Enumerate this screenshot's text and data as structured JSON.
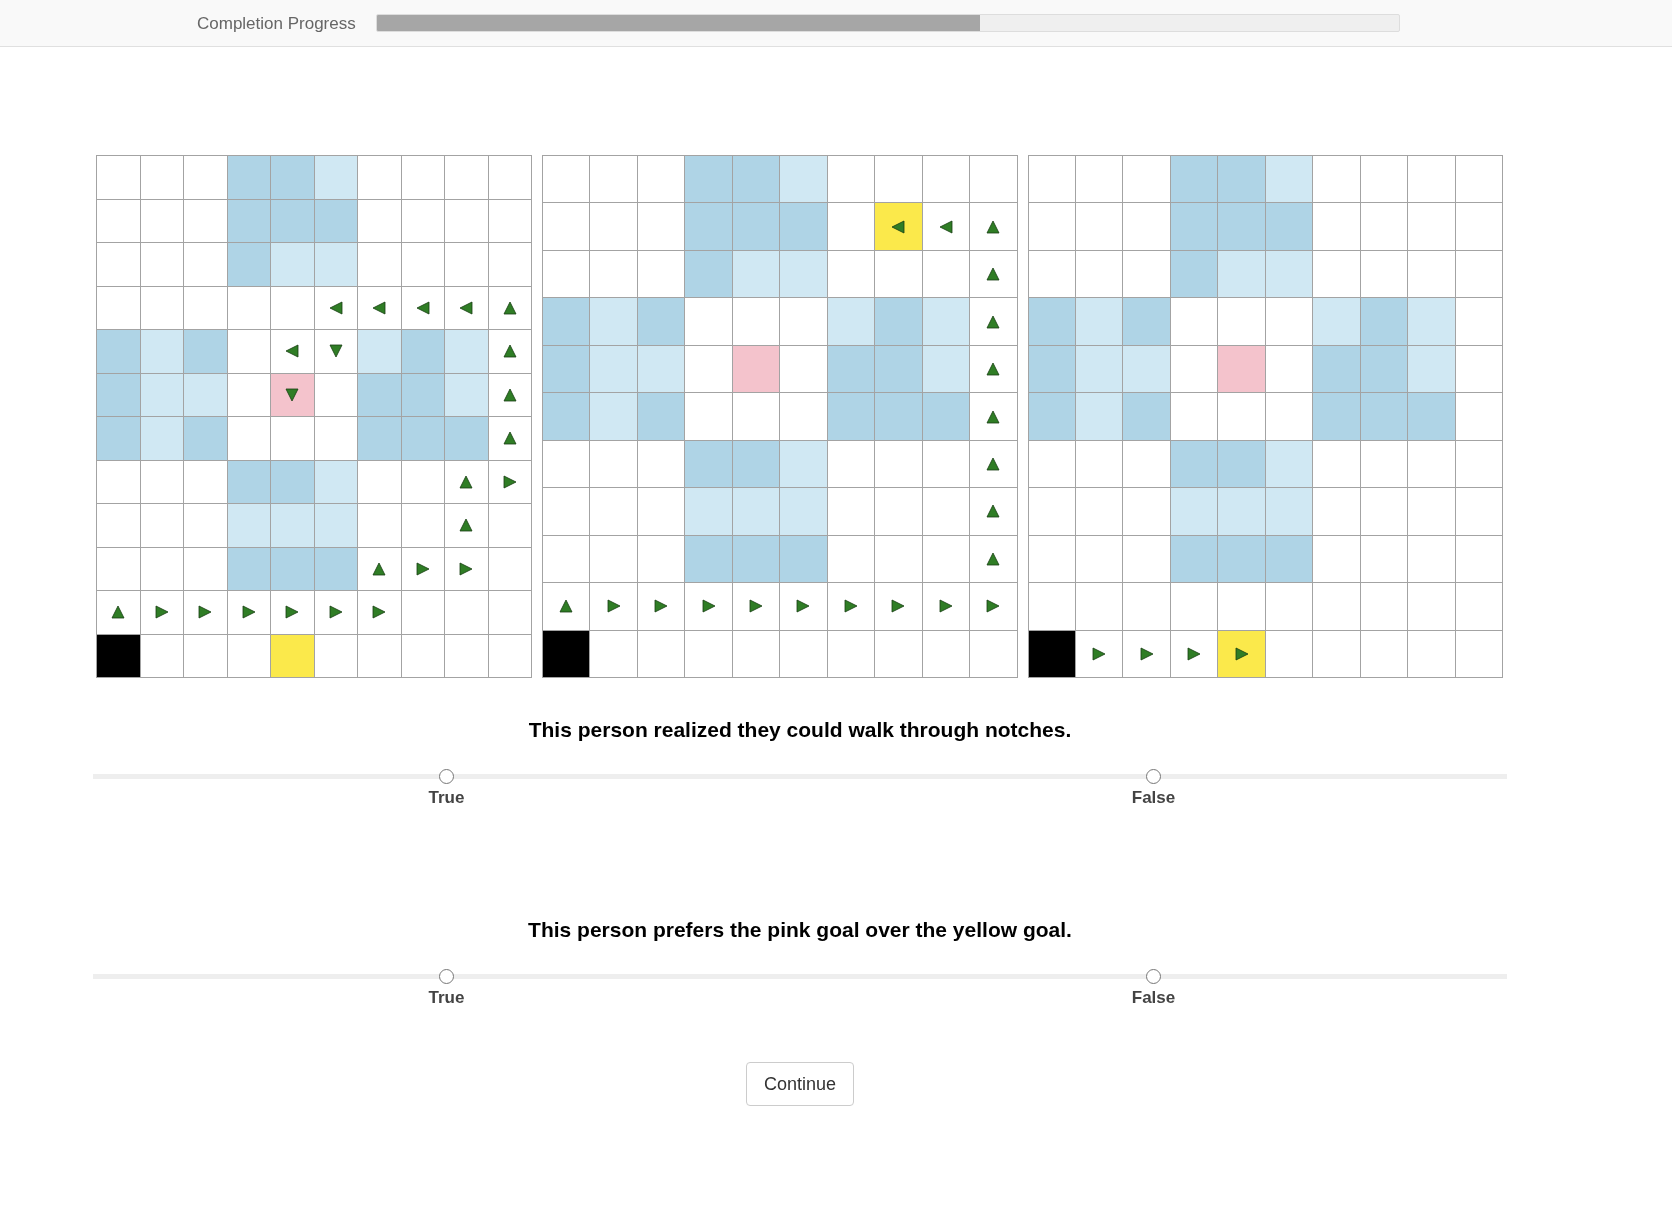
{
  "progress": {
    "label": "Completion Progress",
    "level": 0.59
  },
  "grids": [
    {
      "rows": [
        {
          "cells": [
            {
              "color": "#ffffff",
              "kind": "empty"
            },
            {
              "color": "#ffffff",
              "kind": "empty"
            },
            {
              "color": "#ffffff",
              "kind": "empty"
            },
            {
              "color": "#afd4e6",
              "kind": "empty"
            },
            {
              "color": "#afd4e6",
              "kind": "empty"
            },
            {
              "color": "#d0e8f3",
              "kind": "empty"
            },
            {
              "color": "#ffffff",
              "kind": "empty"
            },
            {
              "color": "#ffffff",
              "kind": "empty"
            },
            {
              "color": "#ffffff",
              "kind": "empty"
            },
            {
              "color": "#ffffff",
              "kind": "empty"
            }
          ]
        },
        {
          "cells": [
            {
              "color": "#ffffff",
              "kind": "empty"
            },
            {
              "color": "#ffffff",
              "kind": "empty"
            },
            {
              "color": "#ffffff",
              "kind": "empty"
            },
            {
              "color": "#afd4e6",
              "kind": "empty"
            },
            {
              "color": "#afd4e6",
              "kind": "empty"
            },
            {
              "color": "#afd4e6",
              "kind": "empty"
            },
            {
              "color": "#ffffff",
              "kind": "empty"
            },
            {
              "color": "#ffffff",
              "kind": "empty"
            },
            {
              "color": "#ffffff",
              "kind": "empty"
            },
            {
              "color": "#ffffff",
              "kind": "empty"
            }
          ]
        },
        {
          "cells": [
            {
              "color": "#ffffff",
              "kind": "empty"
            },
            {
              "color": "#ffffff",
              "kind": "empty"
            },
            {
              "color": "#ffffff",
              "kind": "empty"
            },
            {
              "color": "#afd4e6",
              "kind": "empty"
            },
            {
              "color": "#d0e8f3",
              "kind": "empty"
            },
            {
              "color": "#d0e8f3",
              "kind": "empty"
            },
            {
              "color": "#ffffff",
              "kind": "empty"
            },
            {
              "color": "#ffffff",
              "kind": "empty"
            },
            {
              "color": "#ffffff",
              "kind": "empty"
            },
            {
              "color": "#ffffff",
              "kind": "empty"
            }
          ]
        },
        {
          "cells": [
            {
              "color": "#ffffff",
              "kind": "empty"
            },
            {
              "color": "#ffffff",
              "kind": "empty"
            },
            {
              "color": "#ffffff",
              "kind": "empty"
            },
            {
              "color": "#ffffff",
              "kind": "empty"
            },
            {
              "color": "#ffffff",
              "kind": "empty"
            },
            {
              "color": "#ffffff",
              "kind": "left"
            },
            {
              "color": "#ffffff",
              "kind": "left"
            },
            {
              "color": "#ffffff",
              "kind": "left"
            },
            {
              "color": "#ffffff",
              "kind": "left"
            },
            {
              "color": "#ffffff",
              "kind": "up"
            }
          ]
        },
        {
          "cells": [
            {
              "color": "#afd4e6",
              "kind": "empty"
            },
            {
              "color": "#d0e8f3",
              "kind": "empty"
            },
            {
              "color": "#afd4e6",
              "kind": "empty"
            },
            {
              "color": "#ffffff",
              "kind": "empty"
            },
            {
              "color": "#ffffff",
              "kind": "left"
            },
            {
              "color": "#ffffff",
              "kind": "down"
            },
            {
              "color": "#d0e8f3",
              "kind": "empty"
            },
            {
              "color": "#afd4e6",
              "kind": "empty"
            },
            {
              "color": "#d0e8f3",
              "kind": "empty"
            },
            {
              "color": "#ffffff",
              "kind": "up"
            }
          ]
        },
        {
          "cells": [
            {
              "color": "#afd4e6",
              "kind": "empty"
            },
            {
              "color": "#d0e8f3",
              "kind": "empty"
            },
            {
              "color": "#d0e8f3",
              "kind": "empty"
            },
            {
              "color": "#ffffff",
              "kind": "empty"
            },
            {
              "color": "#f4c3cc",
              "kind": "down"
            },
            {
              "color": "#ffffff",
              "kind": "empty"
            },
            {
              "color": "#afd4e6",
              "kind": "empty"
            },
            {
              "color": "#afd4e6",
              "kind": "empty"
            },
            {
              "color": "#d0e8f3",
              "kind": "empty"
            },
            {
              "color": "#ffffff",
              "kind": "up"
            }
          ]
        },
        {
          "cells": [
            {
              "color": "#afd4e6",
              "kind": "empty"
            },
            {
              "color": "#d0e8f3",
              "kind": "empty"
            },
            {
              "color": "#afd4e6",
              "kind": "empty"
            },
            {
              "color": "#ffffff",
              "kind": "empty"
            },
            {
              "color": "#ffffff",
              "kind": "empty"
            },
            {
              "color": "#ffffff",
              "kind": "empty"
            },
            {
              "color": "#afd4e6",
              "kind": "empty"
            },
            {
              "color": "#afd4e6",
              "kind": "empty"
            },
            {
              "color": "#afd4e6",
              "kind": "empty"
            },
            {
              "color": "#ffffff",
              "kind": "up"
            }
          ]
        },
        {
          "cells": [
            {
              "color": "#ffffff",
              "kind": "empty"
            },
            {
              "color": "#ffffff",
              "kind": "empty"
            },
            {
              "color": "#ffffff",
              "kind": "empty"
            },
            {
              "color": "#afd4e6",
              "kind": "empty"
            },
            {
              "color": "#afd4e6",
              "kind": "empty"
            },
            {
              "color": "#d0e8f3",
              "kind": "empty"
            },
            {
              "color": "#ffffff",
              "kind": "empty"
            },
            {
              "color": "#ffffff",
              "kind": "empty"
            },
            {
              "color": "#ffffff",
              "kind": "up"
            },
            {
              "color": "#ffffff",
              "kind": "right"
            }
          ]
        },
        {
          "cells": [
            {
              "color": "#ffffff",
              "kind": "empty"
            },
            {
              "color": "#ffffff",
              "kind": "empty"
            },
            {
              "color": "#ffffff",
              "kind": "empty"
            },
            {
              "color": "#d0e8f3",
              "kind": "empty"
            },
            {
              "color": "#d0e8f3",
              "kind": "empty"
            },
            {
              "color": "#d0e8f3",
              "kind": "empty"
            },
            {
              "color": "#ffffff",
              "kind": "empty"
            },
            {
              "color": "#ffffff",
              "kind": "empty"
            },
            {
              "color": "#ffffff",
              "kind": "up"
            },
            {
              "color": "#ffffff",
              "kind": "empty"
            }
          ]
        },
        {
          "cells": [
            {
              "color": "#ffffff",
              "kind": "empty"
            },
            {
              "color": "#ffffff",
              "kind": "empty"
            },
            {
              "color": "#ffffff",
              "kind": "empty"
            },
            {
              "color": "#afd4e6",
              "kind": "empty"
            },
            {
              "color": "#afd4e6",
              "kind": "empty"
            },
            {
              "color": "#afd4e6",
              "kind": "empty"
            },
            {
              "color": "#ffffff",
              "kind": "up"
            },
            {
              "color": "#ffffff",
              "kind": "right"
            },
            {
              "color": "#ffffff",
              "kind": "right"
            },
            {
              "color": "#ffffff",
              "kind": "empty"
            }
          ]
        },
        {
          "cells": [
            {
              "color": "#ffffff",
              "kind": "up"
            },
            {
              "color": "#ffffff",
              "kind": "right"
            },
            {
              "color": "#ffffff",
              "kind": "right"
            },
            {
              "color": "#ffffff",
              "kind": "right"
            },
            {
              "color": "#ffffff",
              "kind": "right"
            },
            {
              "color": "#ffffff",
              "kind": "right"
            },
            {
              "color": "#ffffff",
              "kind": "right"
            },
            {
              "color": "#ffffff",
              "kind": "empty"
            },
            {
              "color": "#ffffff",
              "kind": "empty"
            },
            {
              "color": "#ffffff",
              "kind": "empty"
            }
          ]
        },
        {
          "cells": [
            {
              "color": "#000000",
              "kind": "empty"
            },
            {
              "color": "#ffffff",
              "kind": "empty"
            },
            {
              "color": "#ffffff",
              "kind": "empty"
            },
            {
              "color": "#ffffff",
              "kind": "empty"
            },
            {
              "color": "#fbe94b",
              "kind": "empty"
            },
            {
              "color": "#ffffff",
              "kind": "empty"
            },
            {
              "color": "#ffffff",
              "kind": "empty"
            },
            {
              "color": "#ffffff",
              "kind": "empty"
            },
            {
              "color": "#ffffff",
              "kind": "empty"
            },
            {
              "color": "#ffffff",
              "kind": "empty"
            }
          ]
        }
      ]
    },
    {
      "rows": [
        {
          "cells": [
            {
              "color": "#ffffff",
              "kind": "empty"
            },
            {
              "color": "#ffffff",
              "kind": "empty"
            },
            {
              "color": "#ffffff",
              "kind": "empty"
            },
            {
              "color": "#afd4e6",
              "kind": "empty"
            },
            {
              "color": "#afd4e6",
              "kind": "empty"
            },
            {
              "color": "#d0e8f3",
              "kind": "empty"
            },
            {
              "color": "#ffffff",
              "kind": "empty"
            },
            {
              "color": "#ffffff",
              "kind": "empty"
            },
            {
              "color": "#ffffff",
              "kind": "empty"
            },
            {
              "color": "#ffffff",
              "kind": "empty"
            }
          ]
        },
        {
          "cells": [
            {
              "color": "#ffffff",
              "kind": "empty"
            },
            {
              "color": "#ffffff",
              "kind": "empty"
            },
            {
              "color": "#ffffff",
              "kind": "empty"
            },
            {
              "color": "#afd4e6",
              "kind": "empty"
            },
            {
              "color": "#afd4e6",
              "kind": "empty"
            },
            {
              "color": "#afd4e6",
              "kind": "empty"
            },
            {
              "color": "#ffffff",
              "kind": "empty"
            },
            {
              "color": "#fbe94b",
              "kind": "left"
            },
            {
              "color": "#ffffff",
              "kind": "left"
            },
            {
              "color": "#ffffff",
              "kind": "up"
            }
          ]
        },
        {
          "cells": [
            {
              "color": "#ffffff",
              "kind": "empty"
            },
            {
              "color": "#ffffff",
              "kind": "empty"
            },
            {
              "color": "#ffffff",
              "kind": "empty"
            },
            {
              "color": "#afd4e6",
              "kind": "empty"
            },
            {
              "color": "#d0e8f3",
              "kind": "empty"
            },
            {
              "color": "#d0e8f3",
              "kind": "empty"
            },
            {
              "color": "#ffffff",
              "kind": "empty"
            },
            {
              "color": "#ffffff",
              "kind": "empty"
            },
            {
              "color": "#ffffff",
              "kind": "empty"
            },
            {
              "color": "#ffffff",
              "kind": "up"
            }
          ]
        },
        {
          "cells": [
            {
              "color": "#afd4e6",
              "kind": "empty"
            },
            {
              "color": "#d0e8f3",
              "kind": "empty"
            },
            {
              "color": "#afd4e6",
              "kind": "empty"
            },
            {
              "color": "#ffffff",
              "kind": "empty"
            },
            {
              "color": "#ffffff",
              "kind": "empty"
            },
            {
              "color": "#ffffff",
              "kind": "empty"
            },
            {
              "color": "#d0e8f3",
              "kind": "empty"
            },
            {
              "color": "#afd4e6",
              "kind": "empty"
            },
            {
              "color": "#d0e8f3",
              "kind": "empty"
            },
            {
              "color": "#ffffff",
              "kind": "up"
            }
          ]
        },
        {
          "cells": [
            {
              "color": "#afd4e6",
              "kind": "empty"
            },
            {
              "color": "#d0e8f3",
              "kind": "empty"
            },
            {
              "color": "#d0e8f3",
              "kind": "empty"
            },
            {
              "color": "#ffffff",
              "kind": "empty"
            },
            {
              "color": "#f4c3cc",
              "kind": "empty"
            },
            {
              "color": "#ffffff",
              "kind": "empty"
            },
            {
              "color": "#afd4e6",
              "kind": "empty"
            },
            {
              "color": "#afd4e6",
              "kind": "empty"
            },
            {
              "color": "#d0e8f3",
              "kind": "empty"
            },
            {
              "color": "#ffffff",
              "kind": "up"
            }
          ]
        },
        {
          "cells": [
            {
              "color": "#afd4e6",
              "kind": "empty"
            },
            {
              "color": "#d0e8f3",
              "kind": "empty"
            },
            {
              "color": "#afd4e6",
              "kind": "empty"
            },
            {
              "color": "#ffffff",
              "kind": "empty"
            },
            {
              "color": "#ffffff",
              "kind": "empty"
            },
            {
              "color": "#ffffff",
              "kind": "empty"
            },
            {
              "color": "#afd4e6",
              "kind": "empty"
            },
            {
              "color": "#afd4e6",
              "kind": "empty"
            },
            {
              "color": "#afd4e6",
              "kind": "empty"
            },
            {
              "color": "#ffffff",
              "kind": "up"
            }
          ]
        },
        {
          "cells": [
            {
              "color": "#ffffff",
              "kind": "empty"
            },
            {
              "color": "#ffffff",
              "kind": "empty"
            },
            {
              "color": "#ffffff",
              "kind": "empty"
            },
            {
              "color": "#afd4e6",
              "kind": "empty"
            },
            {
              "color": "#afd4e6",
              "kind": "empty"
            },
            {
              "color": "#d0e8f3",
              "kind": "empty"
            },
            {
              "color": "#ffffff",
              "kind": "empty"
            },
            {
              "color": "#ffffff",
              "kind": "empty"
            },
            {
              "color": "#ffffff",
              "kind": "empty"
            },
            {
              "color": "#ffffff",
              "kind": "up"
            }
          ]
        },
        {
          "cells": [
            {
              "color": "#ffffff",
              "kind": "empty"
            },
            {
              "color": "#ffffff",
              "kind": "empty"
            },
            {
              "color": "#ffffff",
              "kind": "empty"
            },
            {
              "color": "#d0e8f3",
              "kind": "empty"
            },
            {
              "color": "#d0e8f3",
              "kind": "empty"
            },
            {
              "color": "#d0e8f3",
              "kind": "empty"
            },
            {
              "color": "#ffffff",
              "kind": "empty"
            },
            {
              "color": "#ffffff",
              "kind": "empty"
            },
            {
              "color": "#ffffff",
              "kind": "empty"
            },
            {
              "color": "#ffffff",
              "kind": "up"
            }
          ]
        },
        {
          "cells": [
            {
              "color": "#ffffff",
              "kind": "empty"
            },
            {
              "color": "#ffffff",
              "kind": "empty"
            },
            {
              "color": "#ffffff",
              "kind": "empty"
            },
            {
              "color": "#afd4e6",
              "kind": "empty"
            },
            {
              "color": "#afd4e6",
              "kind": "empty"
            },
            {
              "color": "#afd4e6",
              "kind": "empty"
            },
            {
              "color": "#ffffff",
              "kind": "empty"
            },
            {
              "color": "#ffffff",
              "kind": "empty"
            },
            {
              "color": "#ffffff",
              "kind": "empty"
            },
            {
              "color": "#ffffff",
              "kind": "up"
            }
          ]
        },
        {
          "cells": [
            {
              "color": "#ffffff",
              "kind": "up"
            },
            {
              "color": "#ffffff",
              "kind": "right"
            },
            {
              "color": "#ffffff",
              "kind": "right"
            },
            {
              "color": "#ffffff",
              "kind": "right"
            },
            {
              "color": "#ffffff",
              "kind": "right"
            },
            {
              "color": "#ffffff",
              "kind": "right"
            },
            {
              "color": "#ffffff",
              "kind": "right"
            },
            {
              "color": "#ffffff",
              "kind": "right"
            },
            {
              "color": "#ffffff",
              "kind": "right"
            },
            {
              "color": "#ffffff",
              "kind": "right"
            }
          ]
        },
        {
          "cells": [
            {
              "color": "#000000",
              "kind": "empty"
            },
            {
              "color": "#ffffff",
              "kind": "empty"
            },
            {
              "color": "#ffffff",
              "kind": "empty"
            },
            {
              "color": "#ffffff",
              "kind": "empty"
            },
            {
              "color": "#ffffff",
              "kind": "empty"
            },
            {
              "color": "#ffffff",
              "kind": "empty"
            },
            {
              "color": "#ffffff",
              "kind": "empty"
            },
            {
              "color": "#ffffff",
              "kind": "empty"
            },
            {
              "color": "#ffffff",
              "kind": "empty"
            },
            {
              "color": "#ffffff",
              "kind": "empty"
            }
          ]
        }
      ]
    },
    {
      "rows": [
        {
          "cells": [
            {
              "color": "#ffffff",
              "kind": "empty"
            },
            {
              "color": "#ffffff",
              "kind": "empty"
            },
            {
              "color": "#ffffff",
              "kind": "empty"
            },
            {
              "color": "#afd4e6",
              "kind": "empty"
            },
            {
              "color": "#afd4e6",
              "kind": "empty"
            },
            {
              "color": "#d0e8f3",
              "kind": "empty"
            },
            {
              "color": "#ffffff",
              "kind": "empty"
            },
            {
              "color": "#ffffff",
              "kind": "empty"
            },
            {
              "color": "#ffffff",
              "kind": "empty"
            },
            {
              "color": "#ffffff",
              "kind": "empty"
            }
          ]
        },
        {
          "cells": [
            {
              "color": "#ffffff",
              "kind": "empty"
            },
            {
              "color": "#ffffff",
              "kind": "empty"
            },
            {
              "color": "#ffffff",
              "kind": "empty"
            },
            {
              "color": "#afd4e6",
              "kind": "empty"
            },
            {
              "color": "#afd4e6",
              "kind": "empty"
            },
            {
              "color": "#afd4e6",
              "kind": "empty"
            },
            {
              "color": "#ffffff",
              "kind": "empty"
            },
            {
              "color": "#ffffff",
              "kind": "empty"
            },
            {
              "color": "#ffffff",
              "kind": "empty"
            },
            {
              "color": "#ffffff",
              "kind": "empty"
            }
          ]
        },
        {
          "cells": [
            {
              "color": "#ffffff",
              "kind": "empty"
            },
            {
              "color": "#ffffff",
              "kind": "empty"
            },
            {
              "color": "#ffffff",
              "kind": "empty"
            },
            {
              "color": "#afd4e6",
              "kind": "empty"
            },
            {
              "color": "#d0e8f3",
              "kind": "empty"
            },
            {
              "color": "#d0e8f3",
              "kind": "empty"
            },
            {
              "color": "#ffffff",
              "kind": "empty"
            },
            {
              "color": "#ffffff",
              "kind": "empty"
            },
            {
              "color": "#ffffff",
              "kind": "empty"
            },
            {
              "color": "#ffffff",
              "kind": "empty"
            }
          ]
        },
        {
          "cells": [
            {
              "color": "#afd4e6",
              "kind": "empty"
            },
            {
              "color": "#d0e8f3",
              "kind": "empty"
            },
            {
              "color": "#afd4e6",
              "kind": "empty"
            },
            {
              "color": "#ffffff",
              "kind": "empty"
            },
            {
              "color": "#ffffff",
              "kind": "empty"
            },
            {
              "color": "#ffffff",
              "kind": "empty"
            },
            {
              "color": "#d0e8f3",
              "kind": "empty"
            },
            {
              "color": "#afd4e6",
              "kind": "empty"
            },
            {
              "color": "#d0e8f3",
              "kind": "empty"
            },
            {
              "color": "#ffffff",
              "kind": "empty"
            }
          ]
        },
        {
          "cells": [
            {
              "color": "#afd4e6",
              "kind": "empty"
            },
            {
              "color": "#d0e8f3",
              "kind": "empty"
            },
            {
              "color": "#d0e8f3",
              "kind": "empty"
            },
            {
              "color": "#ffffff",
              "kind": "empty"
            },
            {
              "color": "#f4c3cc",
              "kind": "empty"
            },
            {
              "color": "#ffffff",
              "kind": "empty"
            },
            {
              "color": "#afd4e6",
              "kind": "empty"
            },
            {
              "color": "#afd4e6",
              "kind": "empty"
            },
            {
              "color": "#d0e8f3",
              "kind": "empty"
            },
            {
              "color": "#ffffff",
              "kind": "empty"
            }
          ]
        },
        {
          "cells": [
            {
              "color": "#afd4e6",
              "kind": "empty"
            },
            {
              "color": "#d0e8f3",
              "kind": "empty"
            },
            {
              "color": "#afd4e6",
              "kind": "empty"
            },
            {
              "color": "#ffffff",
              "kind": "empty"
            },
            {
              "color": "#ffffff",
              "kind": "empty"
            },
            {
              "color": "#ffffff",
              "kind": "empty"
            },
            {
              "color": "#afd4e6",
              "kind": "empty"
            },
            {
              "color": "#afd4e6",
              "kind": "empty"
            },
            {
              "color": "#afd4e6",
              "kind": "empty"
            },
            {
              "color": "#ffffff",
              "kind": "empty"
            }
          ]
        },
        {
          "cells": [
            {
              "color": "#ffffff",
              "kind": "empty"
            },
            {
              "color": "#ffffff",
              "kind": "empty"
            },
            {
              "color": "#ffffff",
              "kind": "empty"
            },
            {
              "color": "#afd4e6",
              "kind": "empty"
            },
            {
              "color": "#afd4e6",
              "kind": "empty"
            },
            {
              "color": "#d0e8f3",
              "kind": "empty"
            },
            {
              "color": "#ffffff",
              "kind": "empty"
            },
            {
              "color": "#ffffff",
              "kind": "empty"
            },
            {
              "color": "#ffffff",
              "kind": "empty"
            },
            {
              "color": "#ffffff",
              "kind": "empty"
            }
          ]
        },
        {
          "cells": [
            {
              "color": "#ffffff",
              "kind": "empty"
            },
            {
              "color": "#ffffff",
              "kind": "empty"
            },
            {
              "color": "#ffffff",
              "kind": "empty"
            },
            {
              "color": "#d0e8f3",
              "kind": "empty"
            },
            {
              "color": "#d0e8f3",
              "kind": "empty"
            },
            {
              "color": "#d0e8f3",
              "kind": "empty"
            },
            {
              "color": "#ffffff",
              "kind": "empty"
            },
            {
              "color": "#ffffff",
              "kind": "empty"
            },
            {
              "color": "#ffffff",
              "kind": "empty"
            },
            {
              "color": "#ffffff",
              "kind": "empty"
            }
          ]
        },
        {
          "cells": [
            {
              "color": "#ffffff",
              "kind": "empty"
            },
            {
              "color": "#ffffff",
              "kind": "empty"
            },
            {
              "color": "#ffffff",
              "kind": "empty"
            },
            {
              "color": "#afd4e6",
              "kind": "empty"
            },
            {
              "color": "#afd4e6",
              "kind": "empty"
            },
            {
              "color": "#afd4e6",
              "kind": "empty"
            },
            {
              "color": "#ffffff",
              "kind": "empty"
            },
            {
              "color": "#ffffff",
              "kind": "empty"
            },
            {
              "color": "#ffffff",
              "kind": "empty"
            },
            {
              "color": "#ffffff",
              "kind": "empty"
            }
          ]
        },
        {
          "cells": [
            {
              "color": "#ffffff",
              "kind": "empty"
            },
            {
              "color": "#ffffff",
              "kind": "empty"
            },
            {
              "color": "#ffffff",
              "kind": "empty"
            },
            {
              "color": "#ffffff",
              "kind": "empty"
            },
            {
              "color": "#ffffff",
              "kind": "empty"
            },
            {
              "color": "#ffffff",
              "kind": "empty"
            },
            {
              "color": "#ffffff",
              "kind": "empty"
            },
            {
              "color": "#ffffff",
              "kind": "empty"
            },
            {
              "color": "#ffffff",
              "kind": "empty"
            },
            {
              "color": "#ffffff",
              "kind": "empty"
            }
          ]
        },
        {
          "cells": [
            {
              "color": "#000000",
              "kind": "empty"
            },
            {
              "color": "#ffffff",
              "kind": "right"
            },
            {
              "color": "#ffffff",
              "kind": "right"
            },
            {
              "color": "#ffffff",
              "kind": "right"
            },
            {
              "color": "#fbe94b",
              "kind": "right"
            },
            {
              "color": "#ffffff",
              "kind": "empty"
            },
            {
              "color": "#ffffff",
              "kind": "empty"
            },
            {
              "color": "#ffffff",
              "kind": "empty"
            },
            {
              "color": "#ffffff",
              "kind": "empty"
            },
            {
              "color": "#ffffff",
              "kind": "empty"
            }
          ]
        }
      ]
    }
  ],
  "questions": [
    {
      "prompt": "This person realized they could walk through notches.",
      "options": [
        {
          "label": "True",
          "selected": false
        },
        {
          "label": "False",
          "selected": false
        }
      ]
    },
    {
      "prompt": "This person prefers the pink goal over the yellow goal.",
      "options": [
        {
          "label": "True",
          "selected": false
        },
        {
          "label": "False",
          "selected": false
        }
      ]
    }
  ],
  "continue_button": {
    "label": "Continue"
  }
}
